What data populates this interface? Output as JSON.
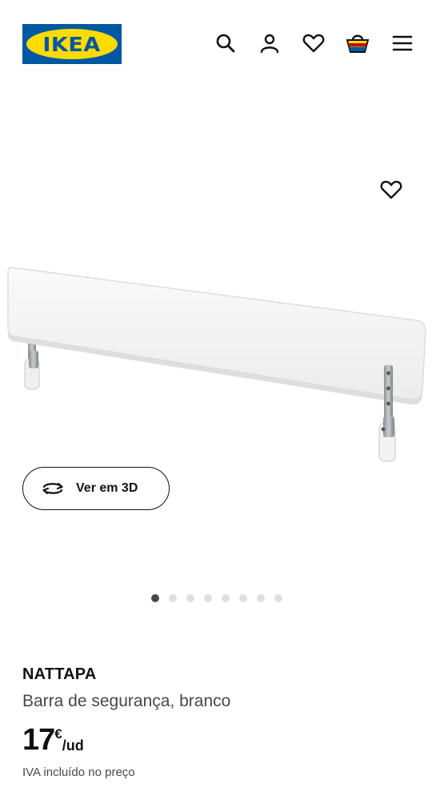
{
  "header": {
    "logo_text": "IKEA",
    "icons": [
      "search-icon",
      "account-icon",
      "wishlist-heart-icon",
      "shopping-basket-icon",
      "menu-icon"
    ]
  },
  "gallery": {
    "favourite_icon": "heart-icon",
    "view_3d_label": "Ver em 3D",
    "view_3d_icon": "rotate-3d-icon",
    "image_count": 8,
    "active_image_index": 0
  },
  "product": {
    "name": "NATTAPA",
    "description": "Barra de segurança, branco",
    "price_integer": "17",
    "price_currency": "€",
    "price_unit": "/ud",
    "vat_note": "IVA incluído no preço"
  },
  "colors": {
    "brand_blue": "#0058a3",
    "brand_yellow": "#ffdb00",
    "text": "#111111",
    "text_secondary": "#484848"
  }
}
